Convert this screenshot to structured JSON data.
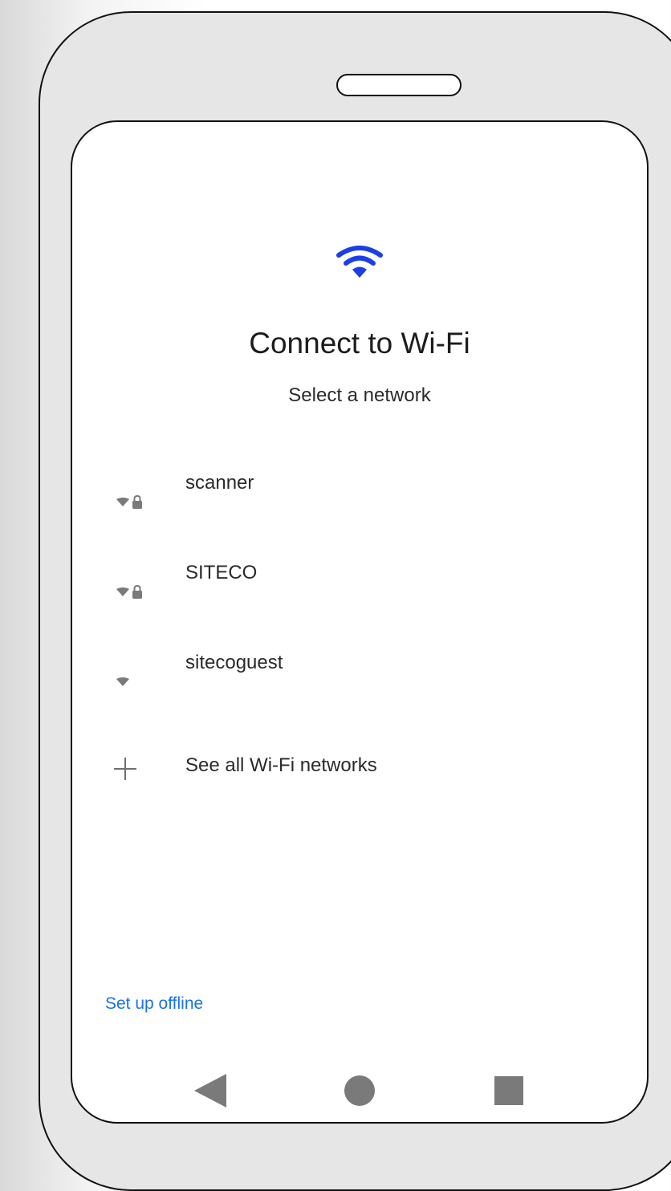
{
  "header": {
    "icon": "wifi-icon",
    "title": "Connect to Wi-Fi",
    "subtitle": "Select a network"
  },
  "networks": [
    {
      "name": "scanner",
      "secured": true,
      "icon": "wifi-lock-icon"
    },
    {
      "name": "SITECO",
      "secured": true,
      "icon": "wifi-lock-icon"
    },
    {
      "name": "sitecoguest",
      "secured": false,
      "icon": "wifi-icon"
    }
  ],
  "see_all": {
    "icon": "plus-icon",
    "label": "See all Wi-Fi networks"
  },
  "offline": {
    "label": "Set up offline"
  },
  "nav": {
    "back_icon": "back-triangle-icon",
    "home_icon": "home-circle-icon",
    "recents_icon": "recents-square-icon"
  },
  "colors": {
    "accent": "#1a73e8",
    "wifi_header": "#1a3fe6",
    "icon_gray": "#7a7a7a",
    "text": "#1c1c1c"
  }
}
